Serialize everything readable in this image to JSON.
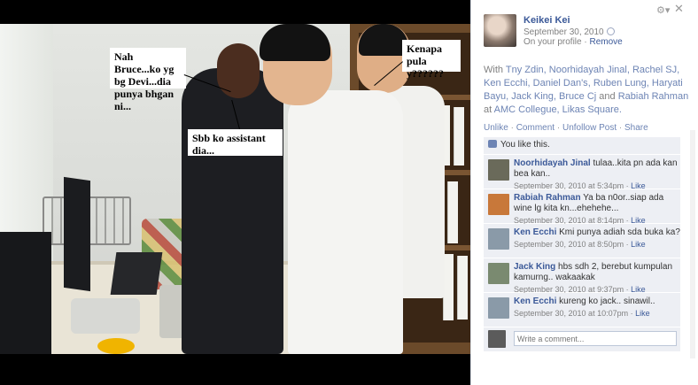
{
  "photo": {
    "captions": [
      "Nah Bruce...ko yg\nbg Devi...dia\npunya bhgan ni...",
      "Kenapa pula\ny??????",
      "Sbb ko assistant dia..."
    ]
  },
  "post": {
    "owner_name": "Keikei Kei",
    "date": "September 30, 2010",
    "on_profile_text": "On your profile",
    "remove_label": "Remove",
    "with_prefix": "With",
    "tagged": [
      "Tny Zdin",
      "Noorhidayah Jinal",
      "Rachel SJ",
      "Ken Ecchi",
      "Daniel Dan's",
      "Ruben Lung",
      "Haryati Bayu",
      "Jack King",
      "Bruce Cj"
    ],
    "and_word": "and",
    "last_tagged": "Rabiah Rahman",
    "at_word": "at",
    "location": "AMC Collegue, Likas Square.",
    "actions": [
      "Unlike",
      "Comment",
      "Unfollow Post",
      "Share"
    ],
    "likes_text": "You like this.",
    "comments": [
      {
        "name": "Noorhidayah Jinal",
        "text": "tulaa..kita pn ada kan bea kan..",
        "time": "September 30, 2010 at 5:34pm",
        "like": "Like",
        "avatar_color": "#6a6a5a"
      },
      {
        "name": "Rabiah Rahman",
        "text": "Ya ba n0or..siap ada wine lg kita kn...ehehehe...",
        "time": "September 30, 2010 at 8:14pm",
        "like": "Like",
        "avatar_color": "#c8783a"
      },
      {
        "name": "Ken Ecchi",
        "text": "Kmi punya adiah sda buka ka?",
        "time": "September 30, 2010 at 8:50pm",
        "like": "Like",
        "avatar_color": "#8a9aa8"
      },
      {
        "name": "Jack King",
        "text": "hbs sdh 2, berebut kumpulan kamurng.. wakaakak",
        "time": "September 30, 2010 at 9:37pm",
        "like": "Like",
        "avatar_color": "#7a8a70"
      },
      {
        "name": "Ken Ecchi",
        "text": "kureng ko jack.. sinawil..",
        "time": "September 30, 2010 at 10:07pm",
        "like": "Like",
        "avatar_color": "#8a9aa8"
      }
    ],
    "write_placeholder": "Write a comment..."
  },
  "colors": {
    "link": "#3b5998",
    "tag_link": "#6d84b4",
    "comment_bg": "#edeff4"
  },
  "icons": [
    "gear-icon",
    "close-icon",
    "globe-icon",
    "thumbs-up-icon"
  ]
}
